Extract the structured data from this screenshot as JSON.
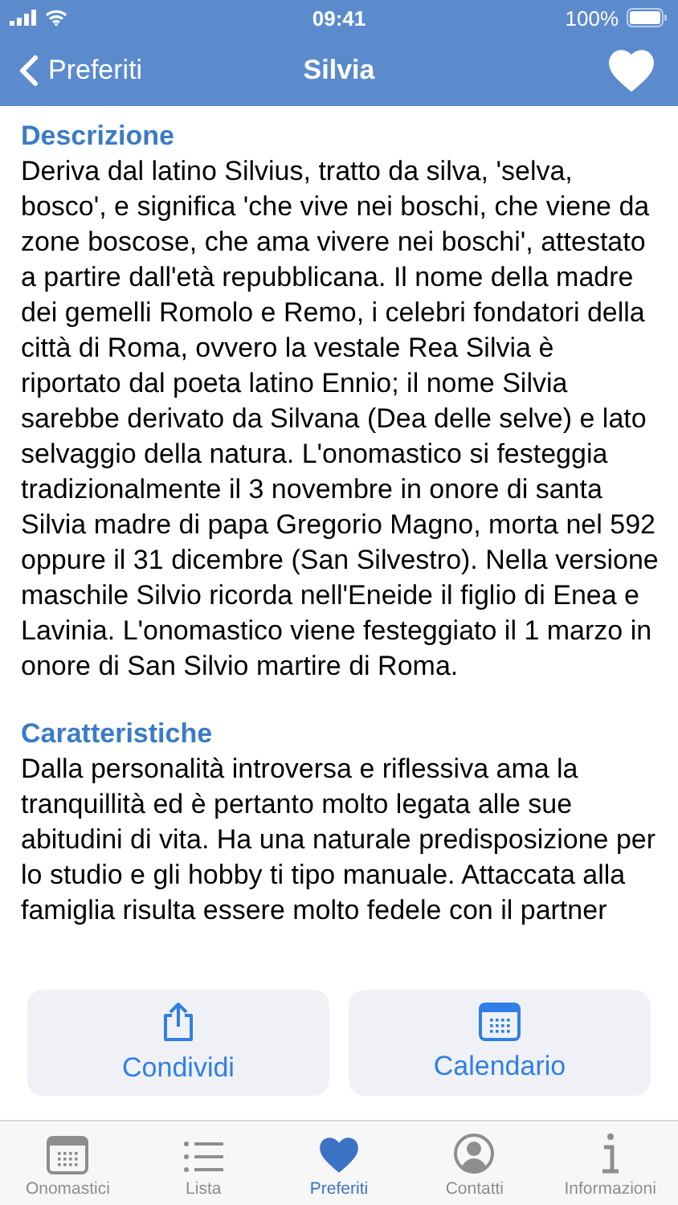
{
  "status_bar": {
    "time": "09:41",
    "battery": "100%"
  },
  "nav": {
    "back": "Preferiti",
    "title": "Silvia",
    "favorite": true
  },
  "sections": [
    {
      "heading": "Descrizione",
      "text": "Deriva dal latino Silvius, tratto da silva, 'selva, bosco', e significa 'che vive nei boschi, che viene da zone boscose, che ama vivere nei boschi', attestato a partire dall'età repubblicana. Il nome della madre dei gemelli Romolo e Remo, i celebri fondatori della città di Roma, ovvero la vestale Rea Silvia è riportato dal poeta latino Ennio; il nome Silvia sarebbe derivato da Silvana (Dea delle selve) e lato selvaggio della natura. L'onomastico si festeggia tradizionalmente il 3 novembre in onore di santa Silvia madre di papa Gregorio Magno, morta nel 592 oppure il 31 dicembre (San Silvestro). Nella versione maschile Silvio ricorda nell'Eneide il figlio di Enea e Lavinia. L'onomastico viene festeggiato il 1 marzo in onore di San Silvio martire di Roma."
    },
    {
      "heading": "Caratteristiche",
      "text": "Dalla personalità introversa e riflessiva ama la tranquillità ed è pertanto molto legata alle sue abitudini di vita. Ha una naturale predisposizione per lo studio e gli hobby ti tipo manuale. Attaccata alla famiglia risulta essere molto fedele con il partner"
    }
  ],
  "actions": [
    {
      "kind": "share",
      "label": "Condividi"
    },
    {
      "kind": "calendar",
      "label": "Calendario"
    }
  ],
  "tabs": [
    {
      "kind": "calendar",
      "label": "Onomastici",
      "selected": false
    },
    {
      "kind": "list",
      "label": "Lista",
      "selected": false
    },
    {
      "kind": "heart",
      "label": "Preferiti",
      "selected": true
    },
    {
      "kind": "person",
      "label": "Contatti",
      "selected": false
    },
    {
      "kind": "info",
      "label": "Informazioni",
      "selected": false
    }
  ]
}
